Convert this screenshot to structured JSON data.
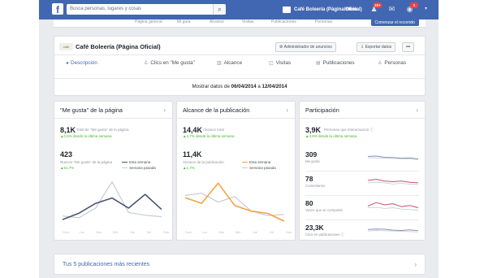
{
  "topbar": {
    "logo": "f",
    "search_placeholder": "Busca personas, lugares y cosas",
    "page_name": "Café Boleería (Página Oficial)",
    "home": "Inicio",
    "notif_count": "20+",
    "msg_count": "1"
  },
  "subnav": {
    "tabs": [
      "Página general",
      "Mi guía",
      "Alcance",
      "Visitas",
      "Publicaciones",
      "Personas"
    ],
    "promote": "Comenzar el recorrido"
  },
  "header": {
    "logo_text": "cafe",
    "title": "Café Boleería (Página Oficial)",
    "ads_manager": "Administrador de anuncios",
    "export": "Exportar datos",
    "more": "•••",
    "date_prefix": "Mostrar datos de",
    "date_from": "06/04/2014",
    "date_sep": "a",
    "date_to": "12/04/2014",
    "tabs": [
      {
        "icon": "◂",
        "label": "Descripción",
        "active": true
      },
      {
        "icon": "♙",
        "label": "Clics en \"Me gusta\""
      },
      {
        "icon": "▥",
        "label": "Alcance"
      },
      {
        "icon": "◫",
        "label": "Visitas"
      },
      {
        "icon": "▤",
        "label": "Publicaciones"
      },
      {
        "icon": "♙",
        "label": "Personas"
      }
    ]
  },
  "likes_card": {
    "title": "\"Me gusta\" de la página",
    "arrow": "›",
    "total": "8,1K",
    "total_label": "Total de \"Me gusta\" de la página",
    "total_change": "▲0,5% desde la última semana",
    "new": "423",
    "new_label": "Nuevos \"Me gusta\" de la página",
    "new_change": "▲51,7%",
    "legend_this": "Esta semana",
    "legend_last": "Semana pasada"
  },
  "reach_card": {
    "title": "Alcance de la publicación",
    "arrow": "›",
    "total": "14,4K",
    "total_label": "Alcance total",
    "total_change": "▲4,7% desde la última semana",
    "value": "11,4K",
    "value_label": "Alcance de la publicación",
    "value_change": "▲1,7%",
    "legend_this": "Esta semana",
    "legend_last": "Semana pasada"
  },
  "part_card": {
    "title": "Participación",
    "arrow": "›",
    "total": "3,9K",
    "total_label": "Personas que interactuaron ⓘ",
    "total_change": "▲3,9% desde la última semana",
    "rows": [
      {
        "num": "309",
        "label": "Me gusta"
      },
      {
        "num": "78",
        "label": "Comentarios"
      },
      {
        "num": "80",
        "label": "Veces que se compartió"
      },
      {
        "num": "23,3K",
        "label": "Clics en publicaciones ⓘ"
      }
    ]
  },
  "days": [
    "Dom",
    "Lun",
    "Mar",
    "Mié",
    "Jue",
    "Vie",
    "Sáb"
  ],
  "recent": {
    "label": "Tus 5 publicaciones más recientes",
    "arrow": "›"
  },
  "colors": {
    "brand": "#4267b2",
    "likes_this": "#4b5673",
    "likes_last": "#c7cbd1",
    "reach_this": "#f5a245",
    "reach_last": "#c7cbd1",
    "positive": "#42b72a"
  },
  "chart_data": [
    {
      "type": "line",
      "x": [
        "Dom",
        "Lun",
        "Mar",
        "Mié",
        "Jue",
        "Vie",
        "Sáb"
      ],
      "series": [
        {
          "name": "Esta semana",
          "values": [
            20,
            38,
            65,
            80,
            52,
            90,
            48
          ]
        },
        {
          "name": "Semana pasada",
          "values": [
            30,
            25,
            52,
            125,
            40,
            32,
            28
          ]
        }
      ],
      "ylim": [
        0,
        140
      ]
    },
    {
      "type": "line",
      "x": [
        "Dom",
        "Lun",
        "Mar",
        "Mié",
        "Jue",
        "Vie",
        "Sáb"
      ],
      "series": [
        {
          "name": "Esta semana",
          "values": [
            2.6,
            2.1,
            3.9,
            1.9,
            1.4,
            1.2,
            0.5
          ]
        },
        {
          "name": "Semana pasada",
          "values": [
            2.8,
            3.0,
            2.2,
            2.7,
            1.4,
            1.0,
            1.1
          ]
        }
      ],
      "ylim": [
        0,
        4.5
      ]
    },
    {
      "type": "line",
      "x": [
        "Dom",
        "Lun",
        "Mar",
        "Mié",
        "Jue",
        "Vie",
        "Sáb"
      ],
      "series": [
        {
          "name": "Esta semana",
          "values": [
            70,
            72,
            64,
            62,
            58,
            60,
            52
          ]
        },
        {
          "name": "Semana pasada",
          "values": [
            62,
            60,
            58,
            55,
            54,
            52,
            48
          ]
        }
      ],
      "ylim": [
        0,
        100
      ]
    },
    {
      "type": "line",
      "x": [
        "Dom",
        "Lun",
        "Mar",
        "Mié",
        "Jue",
        "Vie",
        "Sáb"
      ],
      "series": [
        {
          "name": "Esta semana",
          "values": [
            18,
            20,
            17,
            16,
            17,
            15,
            14
          ]
        },
        {
          "name": "Semana pasada",
          "values": [
            14,
            15,
            14,
            12,
            13,
            12,
            11
          ]
        }
      ],
      "ylim": [
        0,
        25
      ]
    },
    {
      "type": "line",
      "x": [
        "Dom",
        "Lun",
        "Mar",
        "Mié",
        "Jue",
        "Vie",
        "Sáb"
      ],
      "series": [
        {
          "name": "Esta semana",
          "values": [
            16,
            22,
            18,
            20,
            15,
            17,
            13
          ]
        },
        {
          "name": "Semana pasada",
          "values": [
            13,
            14,
            12,
            13,
            11,
            10,
            9
          ]
        }
      ],
      "ylim": [
        0,
        25
      ]
    },
    {
      "type": "line",
      "x": [
        "Dom",
        "Lun",
        "Mar",
        "Mié",
        "Jue",
        "Vie",
        "Sáb"
      ],
      "series": [
        {
          "name": "Esta semana",
          "values": [
            3.5,
            3.7,
            3.6,
            3.3,
            3.2,
            3.4,
            3.1
          ]
        },
        {
          "name": "Semana pasada",
          "values": [
            3.0,
            3.2,
            3.1,
            3.0,
            2.9,
            2.8,
            2.7
          ]
        }
      ],
      "ylim": [
        0,
        5
      ]
    }
  ]
}
